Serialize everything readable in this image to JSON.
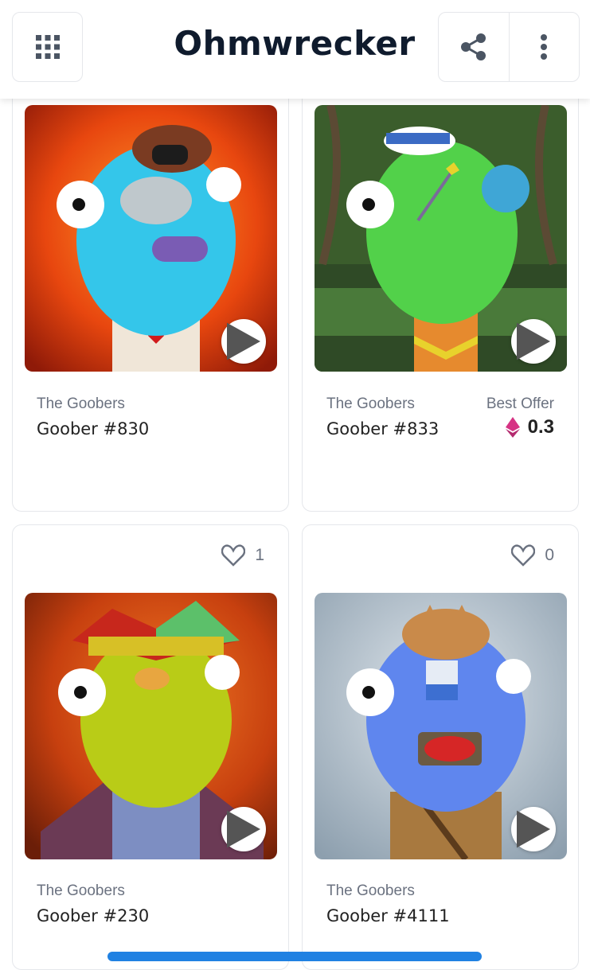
{
  "header": {
    "title": "Ohmwrecker",
    "icons": {
      "left": "grid-icon",
      "share": "share-icon",
      "more": "more-vertical-icon"
    }
  },
  "cards": [
    {
      "collection": "The Goobers",
      "name": "Goober #830",
      "palette": {
        "bg": "#e8470f",
        "body": "#34c6ea"
      }
    },
    {
      "collection": "The Goobers",
      "name": "Goober #833",
      "offer_label": "Best Offer",
      "offer_price": "0.3",
      "palette": {
        "bg": "#3b5d2c",
        "body": "#52d14a"
      }
    },
    {
      "collection": "The Goobers",
      "name": "Goober #230",
      "likes": "1",
      "palette": {
        "bg": "#c7400f",
        "body": "#b9cc17"
      }
    },
    {
      "collection": "The Goobers",
      "name": "Goober #4111",
      "likes": "0",
      "palette": {
        "bg": "#a9b9c7",
        "body": "#5f86ee"
      }
    }
  ],
  "colors": {
    "accent": "#2081e2",
    "eth": "#d63384"
  }
}
